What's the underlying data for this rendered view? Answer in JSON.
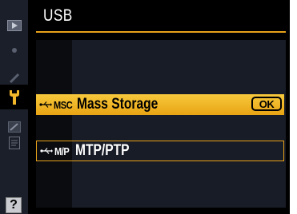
{
  "header": {
    "title": "USB"
  },
  "tabs": [
    {
      "name": "playback-icon",
      "active": false
    },
    {
      "name": "camera-icon",
      "active": false
    },
    {
      "name": "pencil-icon",
      "active": false
    },
    {
      "name": "wrench-icon",
      "active": true
    },
    {
      "name": "retouch-icon",
      "active": false
    },
    {
      "name": "recent-settings-icon",
      "active": false
    }
  ],
  "options": [
    {
      "mode": "MSC",
      "label": "Mass Storage",
      "selected": true,
      "confirm": "OK"
    },
    {
      "mode": "M/P",
      "label": "MTP/PTP",
      "selected": false
    }
  ],
  "help": {
    "label": "?"
  },
  "colors": {
    "accent": "#e8a21a",
    "highlight": "#f4c033",
    "tab_column": "#1b1f29",
    "panel": "#181c26",
    "background": "#000000"
  }
}
